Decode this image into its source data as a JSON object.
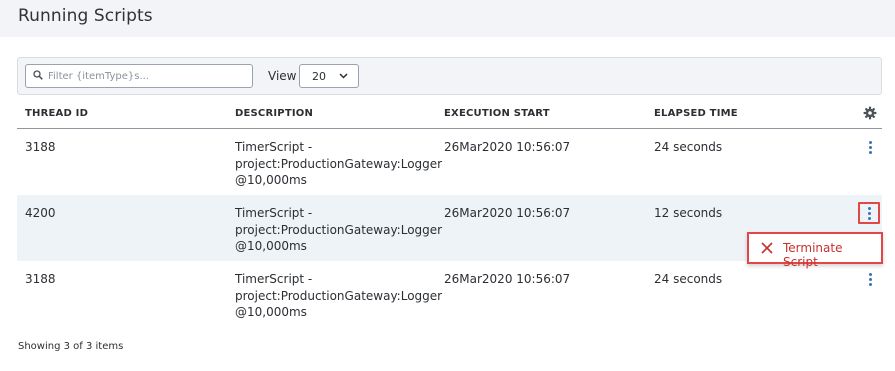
{
  "page": {
    "title": "Running Scripts"
  },
  "toolbar": {
    "filter_placeholder": "Filter {itemType}s...",
    "filter_value": "",
    "view_label": "View",
    "view_value": "20",
    "search_icon": "search-icon",
    "dropdown_icon": "chevron-down-icon"
  },
  "table": {
    "columns": [
      "THREAD ID",
      "DESCRIPTION",
      "EXECUTION START",
      "ELAPSED TIME"
    ],
    "settings_icon": "gear-icon",
    "rows": [
      {
        "thread_id": "3188",
        "description": [
          "TimerScript -",
          "project:ProductionGateway:Logger",
          "@10,000ms"
        ],
        "execution_start": "26Mar2020 10:56:07",
        "elapsed": "24 seconds"
      },
      {
        "thread_id": "4200",
        "description": [
          "TimerScript -",
          "project:ProductionGateway:Logger",
          "@10,000ms"
        ],
        "execution_start": "26Mar2020 10:56:07",
        "elapsed": "12 seconds"
      },
      {
        "thread_id": "3188",
        "description": [
          "TimerScript -",
          "project:ProductionGateway:Logger",
          "@10,000ms"
        ],
        "execution_start": "26Mar2020 10:56:07",
        "elapsed": "24 seconds"
      }
    ]
  },
  "menu": {
    "terminate_label": "Terminate Script",
    "terminate_icon": "close-icon"
  },
  "footer": {
    "summary": "Showing 3 of 3 items"
  },
  "colors": {
    "header_bg": "#f2f4f7",
    "accent_blue": "#3a73b4",
    "highlight_red": "#e04848",
    "danger_text": "#c9302c",
    "selected_row_bg": "#eef3f8"
  }
}
